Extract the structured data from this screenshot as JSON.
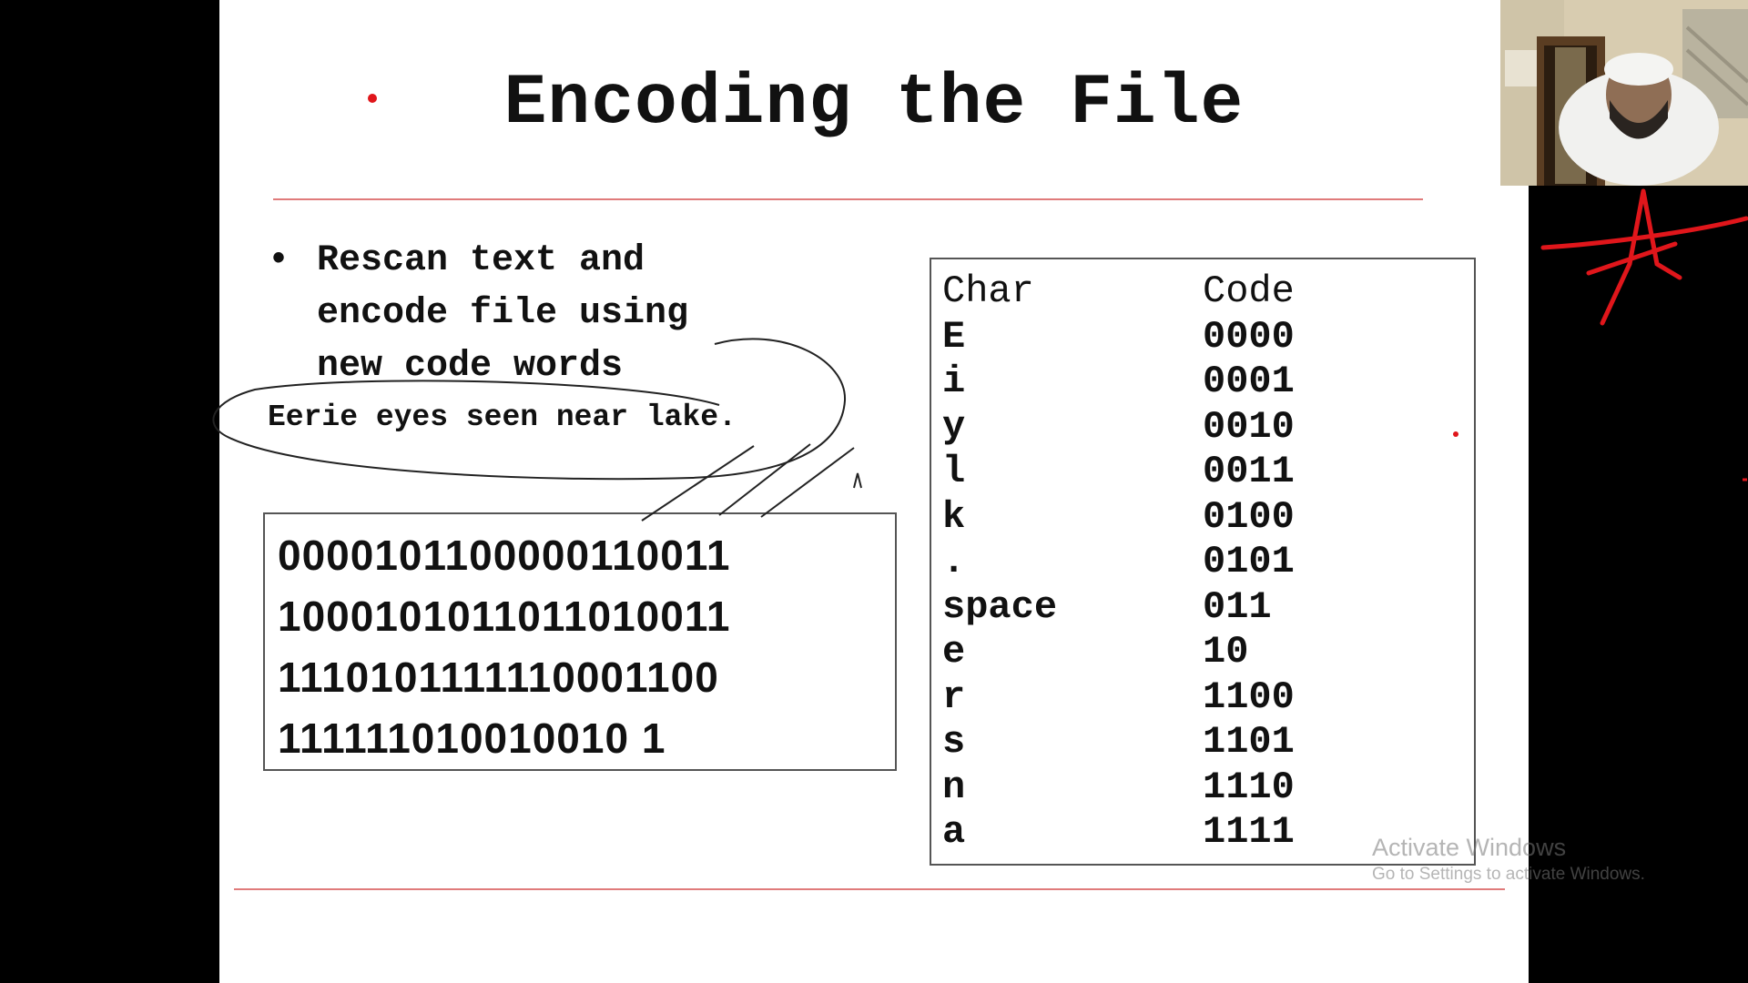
{
  "slide": {
    "title": "Encoding the File",
    "bullet": {
      "marker": "•",
      "lines": [
        "Rescan text and",
        "encode file using",
        "new code words"
      ]
    },
    "example_text": "Eerie eyes seen near lake.",
    "encoded_bits": [
      "0000101100000110011",
      "1000101011011010011",
      "1110101111110001100",
      "111111010010010 1"
    ],
    "code_table": {
      "headers": [
        "Char",
        "Code"
      ],
      "rows": [
        {
          "char": "E",
          "code": "0000"
        },
        {
          "char": "i",
          "code": "0001"
        },
        {
          "char": "y",
          "code": "0010"
        },
        {
          "char": "l",
          "code": "0011"
        },
        {
          "char": "k",
          "code": "0100"
        },
        {
          "char": ".",
          "code": "0101"
        },
        {
          "char": "space",
          "code": "011"
        },
        {
          "char": "e",
          "code": "10"
        },
        {
          "char": "r",
          "code": "1100"
        },
        {
          "char": "s",
          "code": "1101"
        },
        {
          "char": "n",
          "code": "1110"
        },
        {
          "char": "a",
          "code": "1111"
        }
      ]
    }
  },
  "watermark": {
    "title": "Activate Windows",
    "subtitle": "Go to Settings to activate Windows."
  },
  "colors": {
    "accent_rule": "#e07b7b",
    "annotation_ink": "#e0161b",
    "text": "#111111"
  }
}
